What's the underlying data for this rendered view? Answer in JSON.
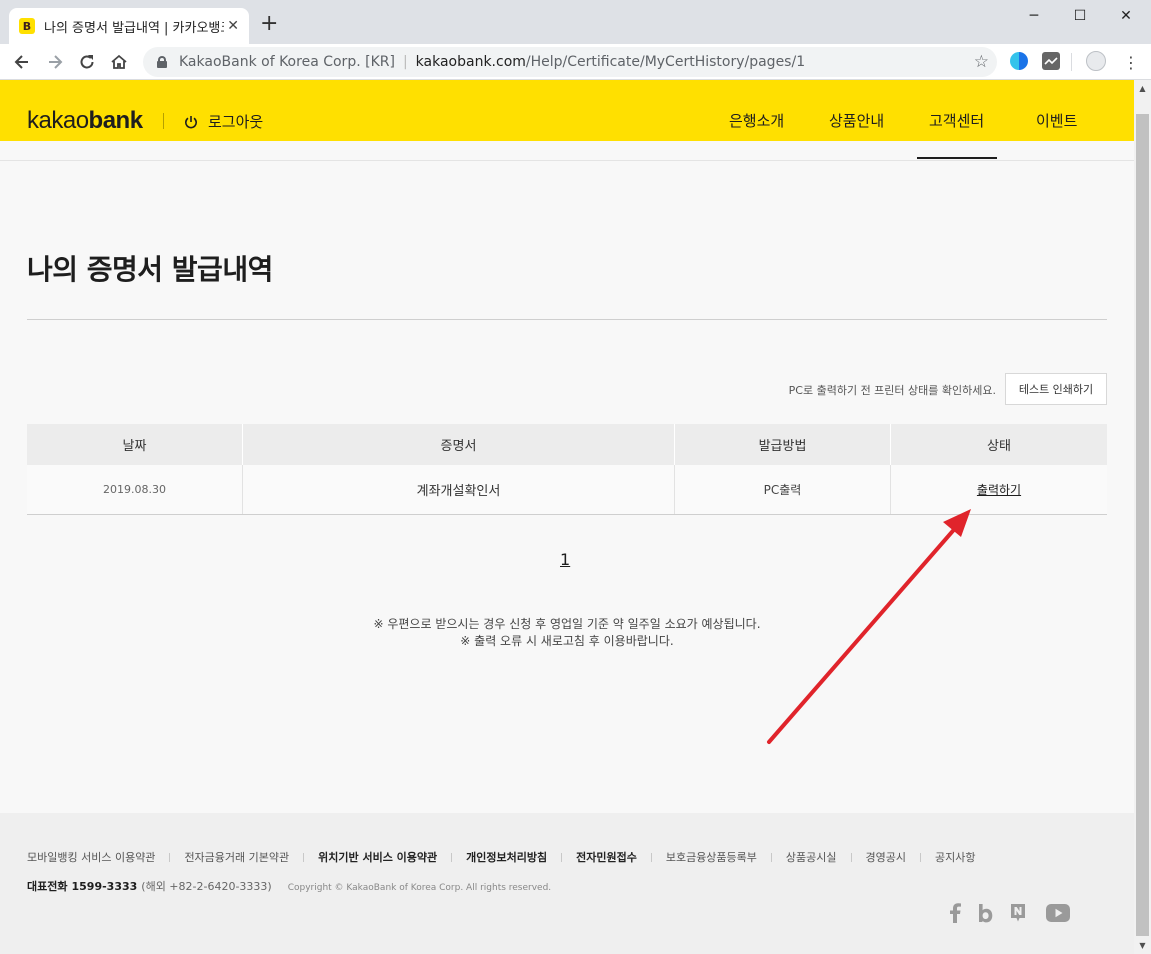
{
  "browser": {
    "tab_title": "나의 증명서 발급내역 | 카카오뱅크",
    "tab_favicon_letter": "B",
    "new_tab_glyph": "+",
    "tab_close_glyph": "✕",
    "window_minimize": "─",
    "window_maximize": "☐",
    "window_close": "✕",
    "cert_org": "KakaoBank of Korea Corp. [KR]",
    "url_host": "kakaobank.com",
    "url_path": "/Help/Certificate/MyCertHistory/pages/1",
    "icons": [
      "back-icon",
      "forward-icon",
      "reload-icon",
      "home-icon",
      "lock-icon",
      "star-icon",
      "profile-icon",
      "menu-icon"
    ]
  },
  "header": {
    "logo_light": "kakao",
    "logo_bold": "bank",
    "logout_label": "로그아웃",
    "nav": [
      "은행소개",
      "상품안내",
      "고객센터",
      "이벤트"
    ],
    "active_nav": "고객센터",
    "brand_color": "#ffe000"
  },
  "main": {
    "title": "나의 증명서 발급내역",
    "printer_notice": "PC로 출력하기 전 프린터 상태를 확인하세요.",
    "test_print_label": "테스트 인쇄하기",
    "table": {
      "headers": [
        "날짜",
        "증명서",
        "발급방법",
        "상태"
      ],
      "rows": [
        {
          "date": "2019.08.30",
          "certificate": "계좌개설확인서",
          "method": "PC출력",
          "status": "출력하기"
        }
      ]
    },
    "pagination": [
      "1"
    ],
    "notes": [
      "※ 우편으로 받으시는 경우 신청 후 영업일 기준 약 일주일 소요가 예상됩니다.",
      "※ 출력 오류 시 새로고침 후 이용바랍니다."
    ],
    "annotation_arrow_color": "#e0242b"
  },
  "footer": {
    "links": [
      {
        "label": "모바일뱅킹 서비스 이용약관",
        "bold": false
      },
      {
        "label": "전자금융거래 기본약관",
        "bold": false
      },
      {
        "label": "위치기반 서비스 이용약관",
        "bold": true
      },
      {
        "label": "개인정보처리방침",
        "bold": true
      },
      {
        "label": "전자민원접수",
        "bold": true
      },
      {
        "label": "보호금융상품등록부",
        "bold": false
      },
      {
        "label": "상품공시실",
        "bold": false
      },
      {
        "label": "경영공시",
        "bold": false
      },
      {
        "label": "공지사항",
        "bold": false
      }
    ],
    "tel_label": "대표전화",
    "tel_number": "1599-3333",
    "overseas": "(해외 +82-2-6420-3333)",
    "copyright": "Copyright © KakaoBank of Korea Corp. All rights reserved.",
    "social": [
      "facebook-icon",
      "brunch-icon",
      "naver-post-icon",
      "youtube-icon"
    ]
  }
}
